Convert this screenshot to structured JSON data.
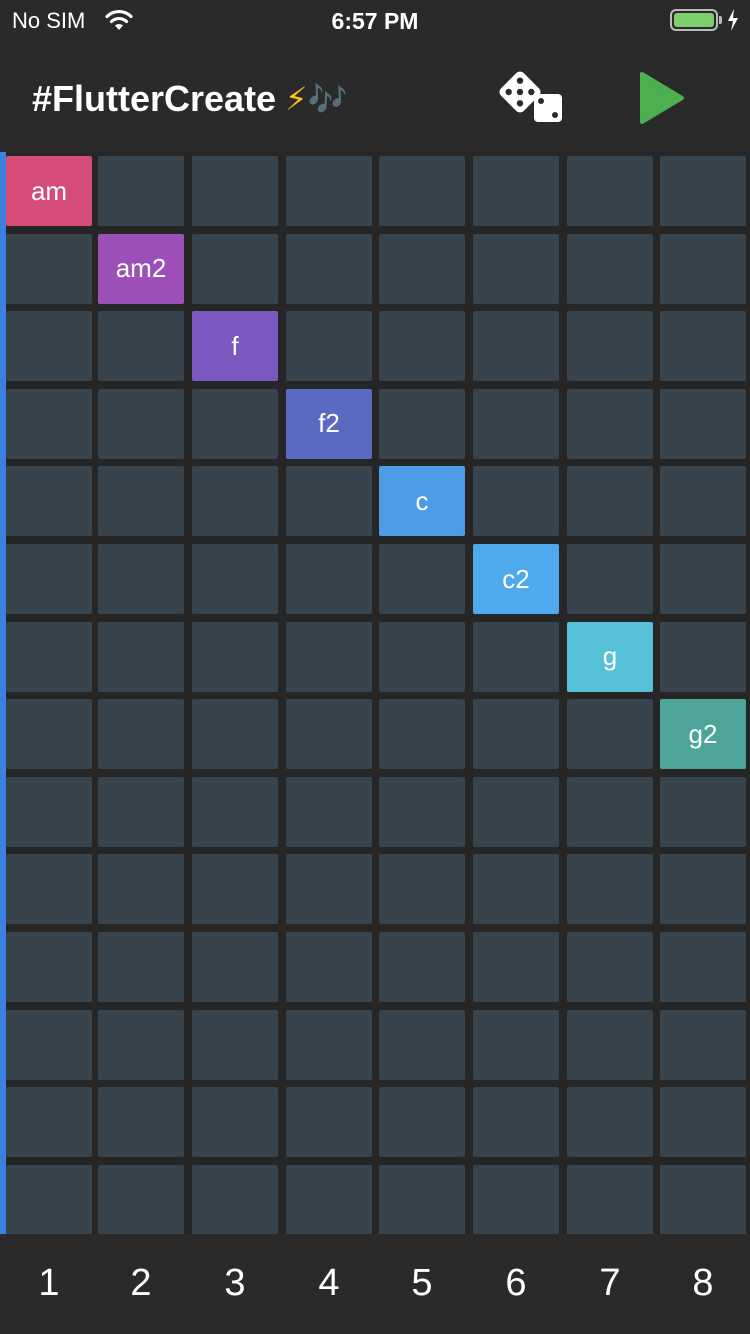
{
  "status_bar": {
    "carrier": "No SIM",
    "time": "6:57 PM",
    "battery_level": 1.0
  },
  "app_bar": {
    "title": "#FlutterCreate",
    "title_emoji": "⚡🎶",
    "actions": [
      {
        "name": "dice-icon",
        "label": "randomize"
      },
      {
        "name": "play-icon",
        "label": "play"
      }
    ]
  },
  "grid": {
    "columns": 8,
    "rows": 14,
    "notes": [
      {
        "label": "am",
        "row": 1,
        "column": 1,
        "color": "#d44c77"
      },
      {
        "label": "am2",
        "row": 2,
        "column": 2,
        "color": "#9c4fb8"
      },
      {
        "label": "f",
        "row": 3,
        "column": 3,
        "color": "#7b58c0"
      },
      {
        "label": "f2",
        "row": 4,
        "column": 4,
        "color": "#5b69c0"
      },
      {
        "label": "c",
        "row": 5,
        "column": 5,
        "color": "#4e9ce8"
      },
      {
        "label": "c2",
        "row": 6,
        "column": 6,
        "color": "#4eaaec"
      },
      {
        "label": "g",
        "row": 7,
        "column": 7,
        "color": "#55c0d6"
      },
      {
        "label": "g2",
        "row": 8,
        "column": 8,
        "color": "#4da59a"
      }
    ],
    "empty_cell_color": "#37444d",
    "playhead_color": "#3b82e0"
  },
  "footer": {
    "column_numbers": [
      "1",
      "2",
      "3",
      "4",
      "5",
      "6",
      "7",
      "8"
    ]
  },
  "colors": {
    "background": "#232323",
    "bar": "#2a2a2a",
    "play_green": "#4caf50",
    "battery_green": "#7ed06e"
  }
}
